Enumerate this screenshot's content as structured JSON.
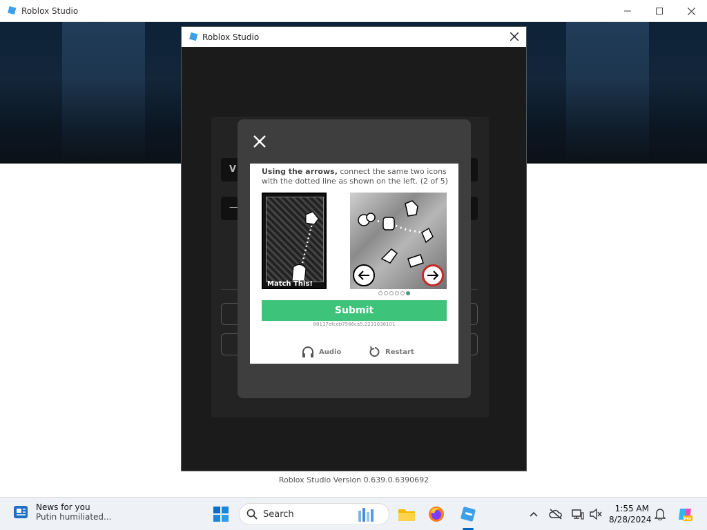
{
  "app": {
    "title": "Roblox Studio",
    "version": "Roblox Studio Version 0.639.0.6390692"
  },
  "dialog": {
    "title": "Roblox Studio",
    "ghost_letters": [
      "V",
      "—"
    ]
  },
  "captcha": {
    "instruction_bold": "Using the arrows,",
    "instruction_rest": " connect the same two icons with the dotted line as shown on the left. (2 of 5)",
    "example_label": "Match This!",
    "progress": {
      "total": 6,
      "current": 6
    },
    "submit_label": "Submit",
    "session_id": "88117efceb7566ca5.2231038101",
    "audio_label": "Audio",
    "restart_label": "Restart"
  },
  "taskbar": {
    "news_title": "News for you",
    "news_headline": "Putin humiliated...",
    "search_label": "Search",
    "time": "1:55 AM",
    "date": "8/28/2024"
  },
  "colors": {
    "submit": "#3ec37a",
    "roblox_blue": "#3d9fe8",
    "captcha_frame": "#3e3e3e"
  }
}
